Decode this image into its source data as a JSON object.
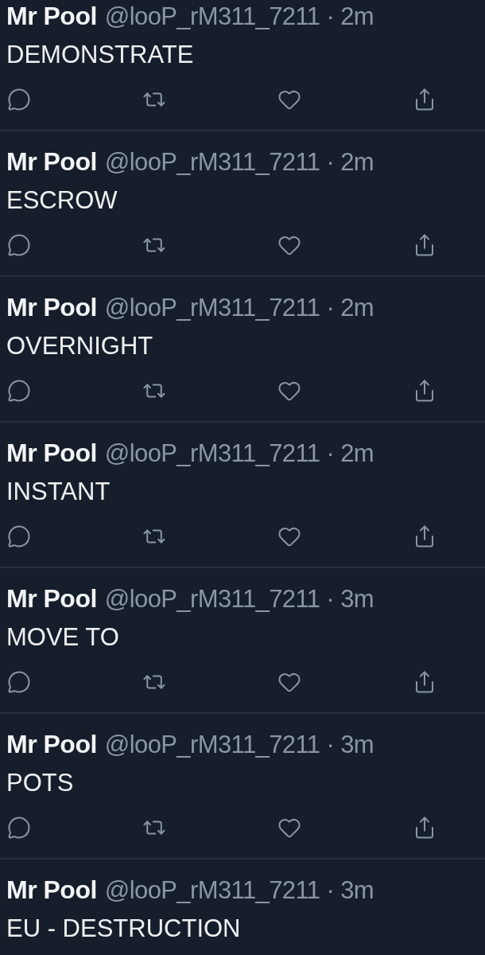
{
  "tweets": [
    {
      "name": "Mr Pool",
      "meta": "@looP_rM311_7211 · 2m",
      "text": "DEMONSTRATE"
    },
    {
      "name": "Mr Pool",
      "meta": "@looP_rM311_7211 · 2m",
      "text": "ESCROW"
    },
    {
      "name": "Mr Pool",
      "meta": "@looP_rM311_7211 · 2m",
      "text": "OVERNIGHT"
    },
    {
      "name": "Mr Pool",
      "meta": "@looP_rM311_7211 · 2m",
      "text": "INSTANT"
    },
    {
      "name": "Mr Pool",
      "meta": "@looP_rM311_7211 · 3m",
      "text": "MOVE TO"
    },
    {
      "name": "Mr Pool",
      "meta": "@looP_rM311_7211 · 3m",
      "text": "POTS"
    },
    {
      "name": "Mr Pool",
      "meta": "@looP_rM311_7211 · 3m",
      "text": "EU - DESTRUCTION"
    }
  ]
}
